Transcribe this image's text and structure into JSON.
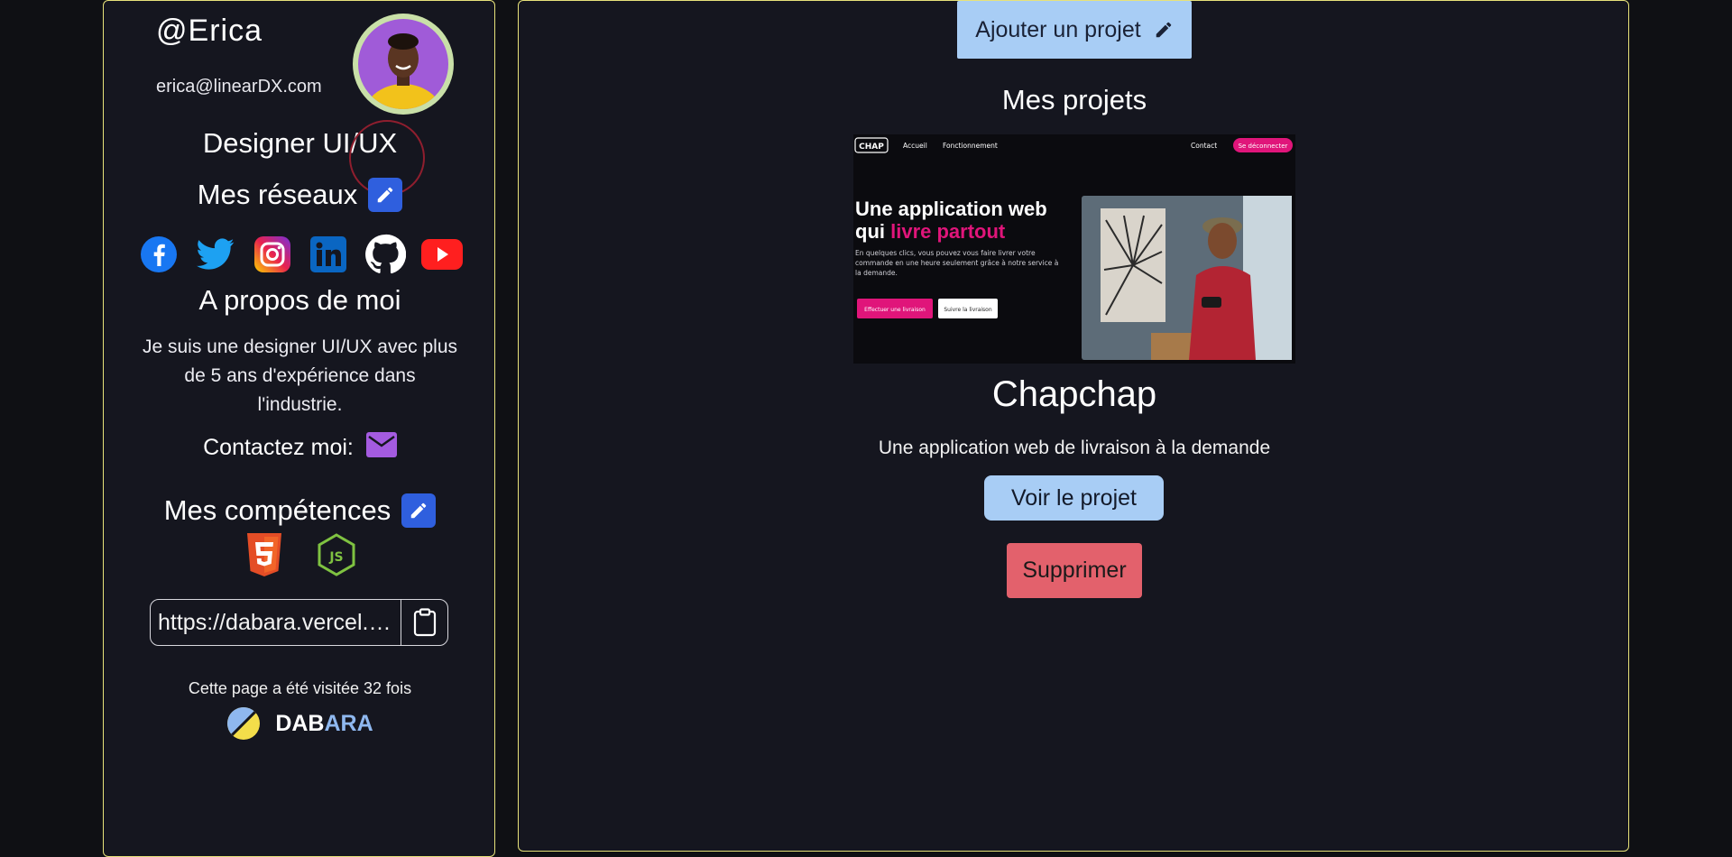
{
  "profile": {
    "handle": "@Erica",
    "email": "erica@linearDX.com",
    "role": "Designer UI/UX"
  },
  "networks": {
    "title": "Mes réseaux",
    "icons": [
      "facebook-icon",
      "twitter-icon",
      "instagram-icon",
      "linkedin-icon",
      "github-icon",
      "youtube-icon"
    ]
  },
  "about": {
    "title": "A propos de moi",
    "text": "Je suis une designer UI/UX avec plus de 5 ans d'expérience dans l'industrie."
  },
  "contact": {
    "label": "Contactez moi:"
  },
  "skills": {
    "title": "Mes compétences",
    "icons": [
      "html5-icon",
      "nodejs-icon"
    ]
  },
  "share": {
    "url": "https://dabara.vercel.app/Erica"
  },
  "footer": {
    "visits": "Cette page a été visitée 32 fois",
    "brand_part1": "DAB",
    "brand_part2": "ARA"
  },
  "main": {
    "add_label": "Ajouter un projet",
    "title": "Mes projets",
    "project": {
      "name": "Chapchap",
      "description": "Une application web de livraison à la demande",
      "view_label": "Voir le projet",
      "delete_label": "Supprimer",
      "preview": {
        "logo": "CHAP",
        "nav_home": "Accueil",
        "nav_how": "Fonctionnement",
        "nav_contact": "Contact",
        "nav_logout": "Se déconnecter",
        "headline_1": "Une application web",
        "headline_2a": "qui ",
        "headline_2b": "livre partout",
        "body": "En quelques clics, vous pouvez vous faire livrer votre commande en une heure seulement grâce à notre service à la demande.",
        "cta_primary": "Effectuer une livraison",
        "cta_secondary": "Suivre la livraison"
      }
    }
  },
  "colors": {
    "accent_border": "#e7e27a",
    "button_blue": "#a8cdf5",
    "delete_red": "#e3616c",
    "edit_blue": "#2f5fde",
    "mail_purple": "#a45be0",
    "preview_pink": "#e0157a"
  }
}
